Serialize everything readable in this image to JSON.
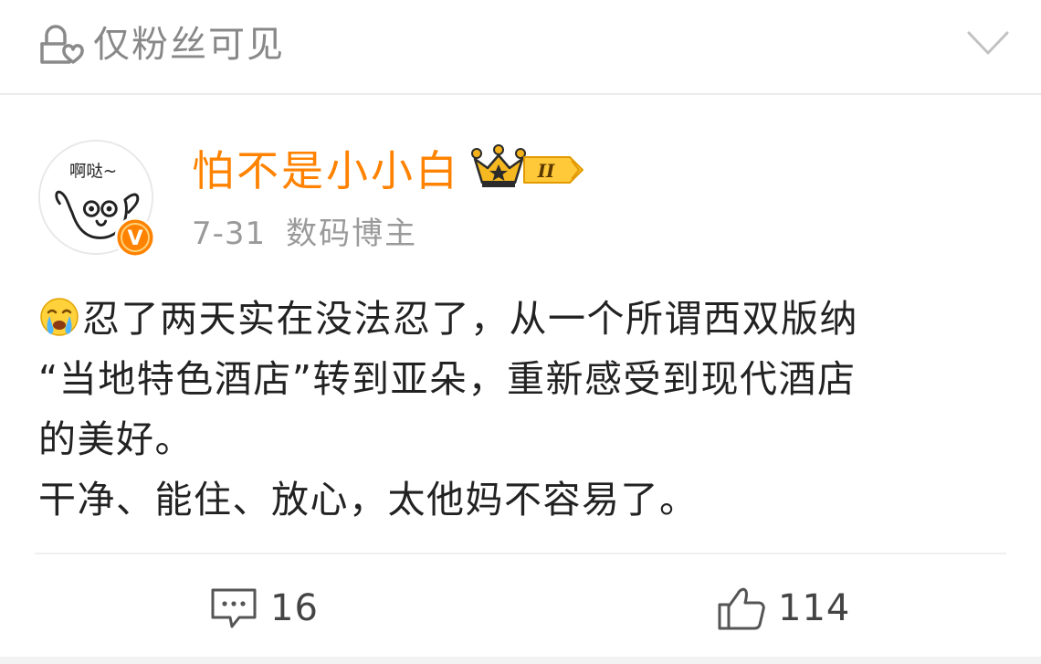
{
  "header": {
    "visibility_label": "仅粉丝可见",
    "visibility_icon": "cloud-lock-icon",
    "expand_icon": "chevron-down-icon"
  },
  "author": {
    "name": "怕不是小小白",
    "avatar_text": "啊哒~",
    "verified_badge": "V",
    "level_badge": "II",
    "name_color": "#ff8200"
  },
  "meta": {
    "date": "7-31",
    "tag": "数码博主"
  },
  "post": {
    "emoji": "crying-face-emoji",
    "lines": [
      "忍了两天实在没法忍了，从一个所谓西双版纳",
      "“当地特色酒店”转到亚朵，重新感受到现代酒店",
      "的美好。",
      "干净、能住、放心，太他妈不容易了。"
    ]
  },
  "actions": {
    "comments": "16",
    "likes": "114"
  },
  "colors": {
    "accent": "#ff8200",
    "text": "#222222",
    "muted": "#9a9a9a",
    "divider": "#efefef"
  }
}
